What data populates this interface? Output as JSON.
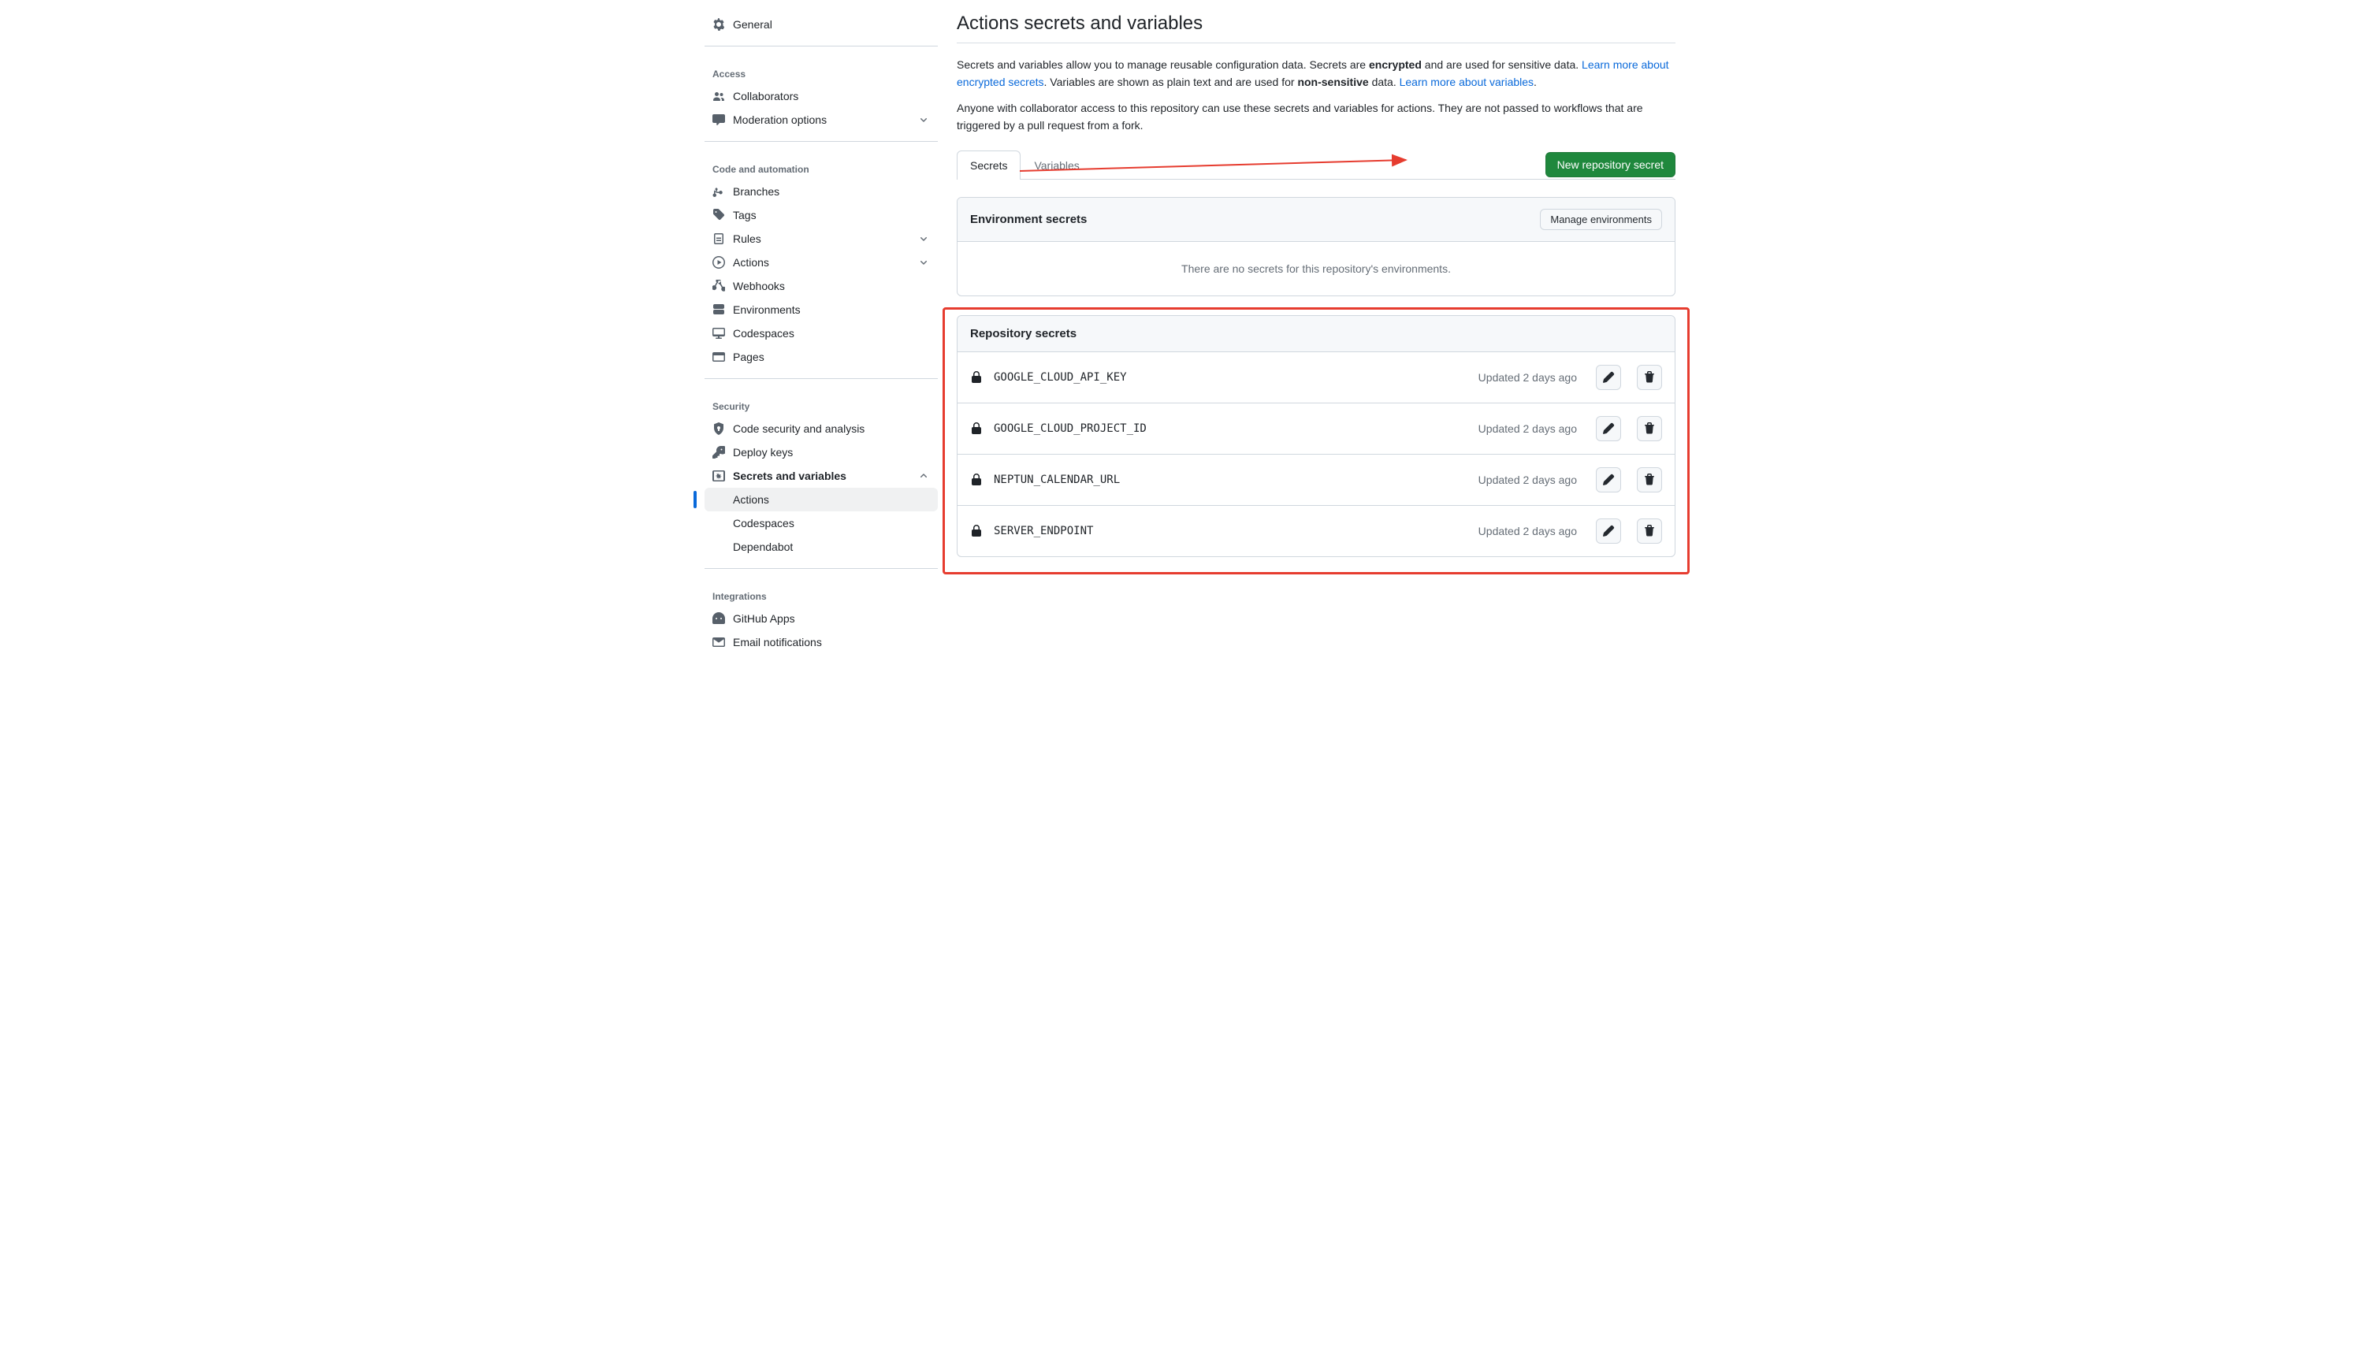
{
  "sidebar": {
    "general_label": "General",
    "groups": [
      {
        "title": "Access",
        "items": [
          {
            "label": "Collaborators",
            "icon": "people",
            "chevron": false
          },
          {
            "label": "Moderation options",
            "icon": "comment",
            "chevron": true
          }
        ]
      },
      {
        "title": "Code and automation",
        "items": [
          {
            "label": "Branches",
            "icon": "branch",
            "chevron": false
          },
          {
            "label": "Tags",
            "icon": "tag",
            "chevron": false
          },
          {
            "label": "Rules",
            "icon": "rules",
            "chevron": true
          },
          {
            "label": "Actions",
            "icon": "play",
            "chevron": true
          },
          {
            "label": "Webhooks",
            "icon": "webhook",
            "chevron": false
          },
          {
            "label": "Environments",
            "icon": "server",
            "chevron": false
          },
          {
            "label": "Codespaces",
            "icon": "codespaces",
            "chevron": false
          },
          {
            "label": "Pages",
            "icon": "browser",
            "chevron": false
          }
        ]
      },
      {
        "title": "Security",
        "items": [
          {
            "label": "Code security and analysis",
            "icon": "shield",
            "chevron": false
          },
          {
            "label": "Deploy keys",
            "icon": "key",
            "chevron": false
          },
          {
            "label": "Secrets and variables",
            "icon": "asterisk",
            "chevron": true,
            "bold": true,
            "expanded": true
          }
        ],
        "subitems": [
          {
            "label": "Actions",
            "active": true
          },
          {
            "label": "Codespaces",
            "active": false
          },
          {
            "label": "Dependabot",
            "active": false
          }
        ]
      },
      {
        "title": "Integrations",
        "items": [
          {
            "label": "GitHub Apps",
            "icon": "hubot",
            "chevron": false
          },
          {
            "label": "Email notifications",
            "icon": "mail",
            "chevron": false
          }
        ]
      }
    ]
  },
  "main": {
    "title": "Actions secrets and variables",
    "intro": {
      "part1": "Secrets and variables allow you to manage reusable configuration data. Secrets are ",
      "bold1": "encrypted",
      "part2": " and are used for sensitive data. ",
      "link1": "Learn more about encrypted secrets",
      "part3": ". Variables are shown as plain text and are used for ",
      "bold2": "non-sensitive",
      "part4": " data. ",
      "link2": "Learn more about variables",
      "part5": ".",
      "para2": "Anyone with collaborator access to this repository can use these secrets and variables for actions. They are not passed to workflows that are triggered by a pull request from a fork."
    },
    "tabs": {
      "secrets": "Secrets",
      "variables": "Variables"
    },
    "new_secret_button": "New repository secret",
    "env_panel": {
      "title": "Environment secrets",
      "manage_button": "Manage environments",
      "empty_text": "There are no secrets for this repository's environments."
    },
    "repo_panel": {
      "title": "Repository secrets",
      "rows": [
        {
          "name": "GOOGLE_CLOUD_API_KEY",
          "updated": "Updated 2 days ago"
        },
        {
          "name": "GOOGLE_CLOUD_PROJECT_ID",
          "updated": "Updated 2 days ago"
        },
        {
          "name": "NEPTUN_CALENDAR_URL",
          "updated": "Updated 2 days ago"
        },
        {
          "name": "SERVER_ENDPOINT",
          "updated": "Updated 2 days ago"
        }
      ]
    }
  },
  "colors": {
    "accent": "#0969da",
    "primary_btn": "#1f883d",
    "annotation": "#e63c2f"
  }
}
